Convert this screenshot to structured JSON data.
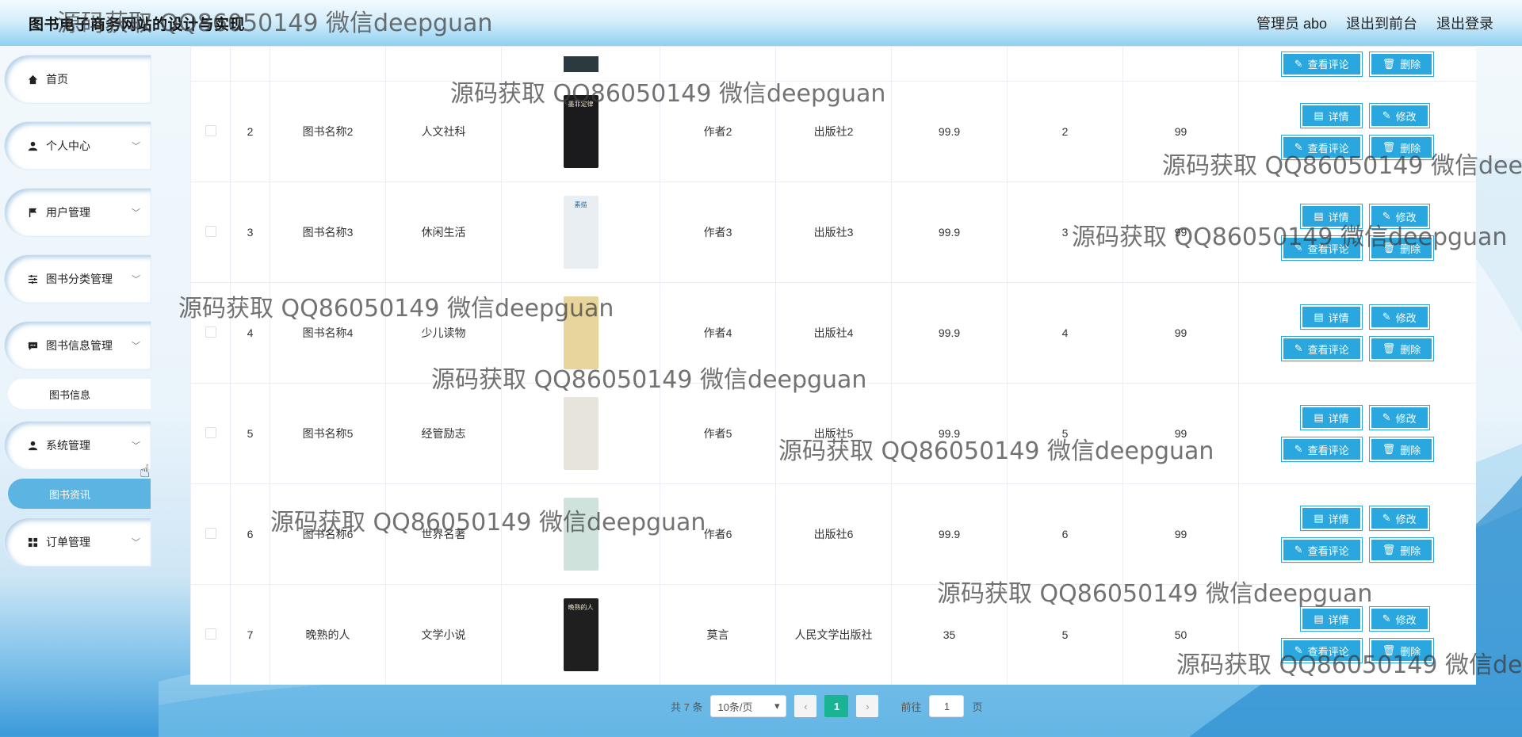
{
  "header": {
    "title": "图书电子商务网站的设计与实现",
    "user_label": "管理员 abo",
    "front_link": "退出到前台",
    "logout_link": "退出登录"
  },
  "sidebar": {
    "home": "首页",
    "personal": "个人中心",
    "user_mgmt": "用户管理",
    "category_mgmt": "图书分类管理",
    "book_info_mgmt": "图书信息管理",
    "book_info": "图书信息",
    "system_mgmt": "系统管理",
    "book_news": "图书资讯",
    "order_mgmt": "订单管理"
  },
  "actions": {
    "detail": "详情",
    "edit": "修改",
    "view_comments": "查看评论",
    "delete": "删除"
  },
  "rows": [
    {
      "index": "2",
      "name": "图书名称2",
      "category": "人文社科",
      "author": "作者2",
      "publisher": "出版社2",
      "price": "99.9",
      "stock": "2",
      "score": "99",
      "cover_color": "#1b1b1d",
      "cover_title": "墨菲定律"
    },
    {
      "index": "3",
      "name": "图书名称3",
      "category": "休闲生活",
      "author": "作者3",
      "publisher": "出版社3",
      "price": "99.9",
      "stock": "3",
      "score": "99",
      "cover_color": "#e9eef2",
      "cover_title": "素描"
    },
    {
      "index": "4",
      "name": "图书名称4",
      "category": "少儿读物",
      "author": "作者4",
      "publisher": "出版社4",
      "price": "99.9",
      "stock": "4",
      "score": "99",
      "cover_color": "#e8d59b",
      "cover_title": ""
    },
    {
      "index": "5",
      "name": "图书名称5",
      "category": "经管励志",
      "author": "作者5",
      "publisher": "出版社5",
      "price": "99.9",
      "stock": "5",
      "score": "99",
      "cover_color": "#e7e4dc",
      "cover_title": ""
    },
    {
      "index": "6",
      "name": "图书名称6",
      "category": "世界名著",
      "author": "作者6",
      "publisher": "出版社6",
      "price": "99.9",
      "stock": "6",
      "score": "99",
      "cover_color": "#cfe3dc",
      "cover_title": ""
    },
    {
      "index": "7",
      "name": "晚熟的人",
      "category": "文学小说",
      "author": "莫言",
      "publisher": "人民文学出版社",
      "price": "35",
      "stock": "5",
      "score": "50",
      "cover_color": "#1f1f1f",
      "cover_title": "晚熟的人"
    }
  ],
  "pagination": {
    "total": "共 7 条",
    "page_size": "10条/页",
    "current": "1",
    "goto_label": "前往",
    "goto_value": "1",
    "page_unit": "页"
  },
  "watermark": "源码获取 QQ86050149 微信deepguan",
  "colors": {
    "accent": "#29a7de",
    "pager_active": "#1ab394",
    "sidebar_active": "#5bb4e2"
  }
}
